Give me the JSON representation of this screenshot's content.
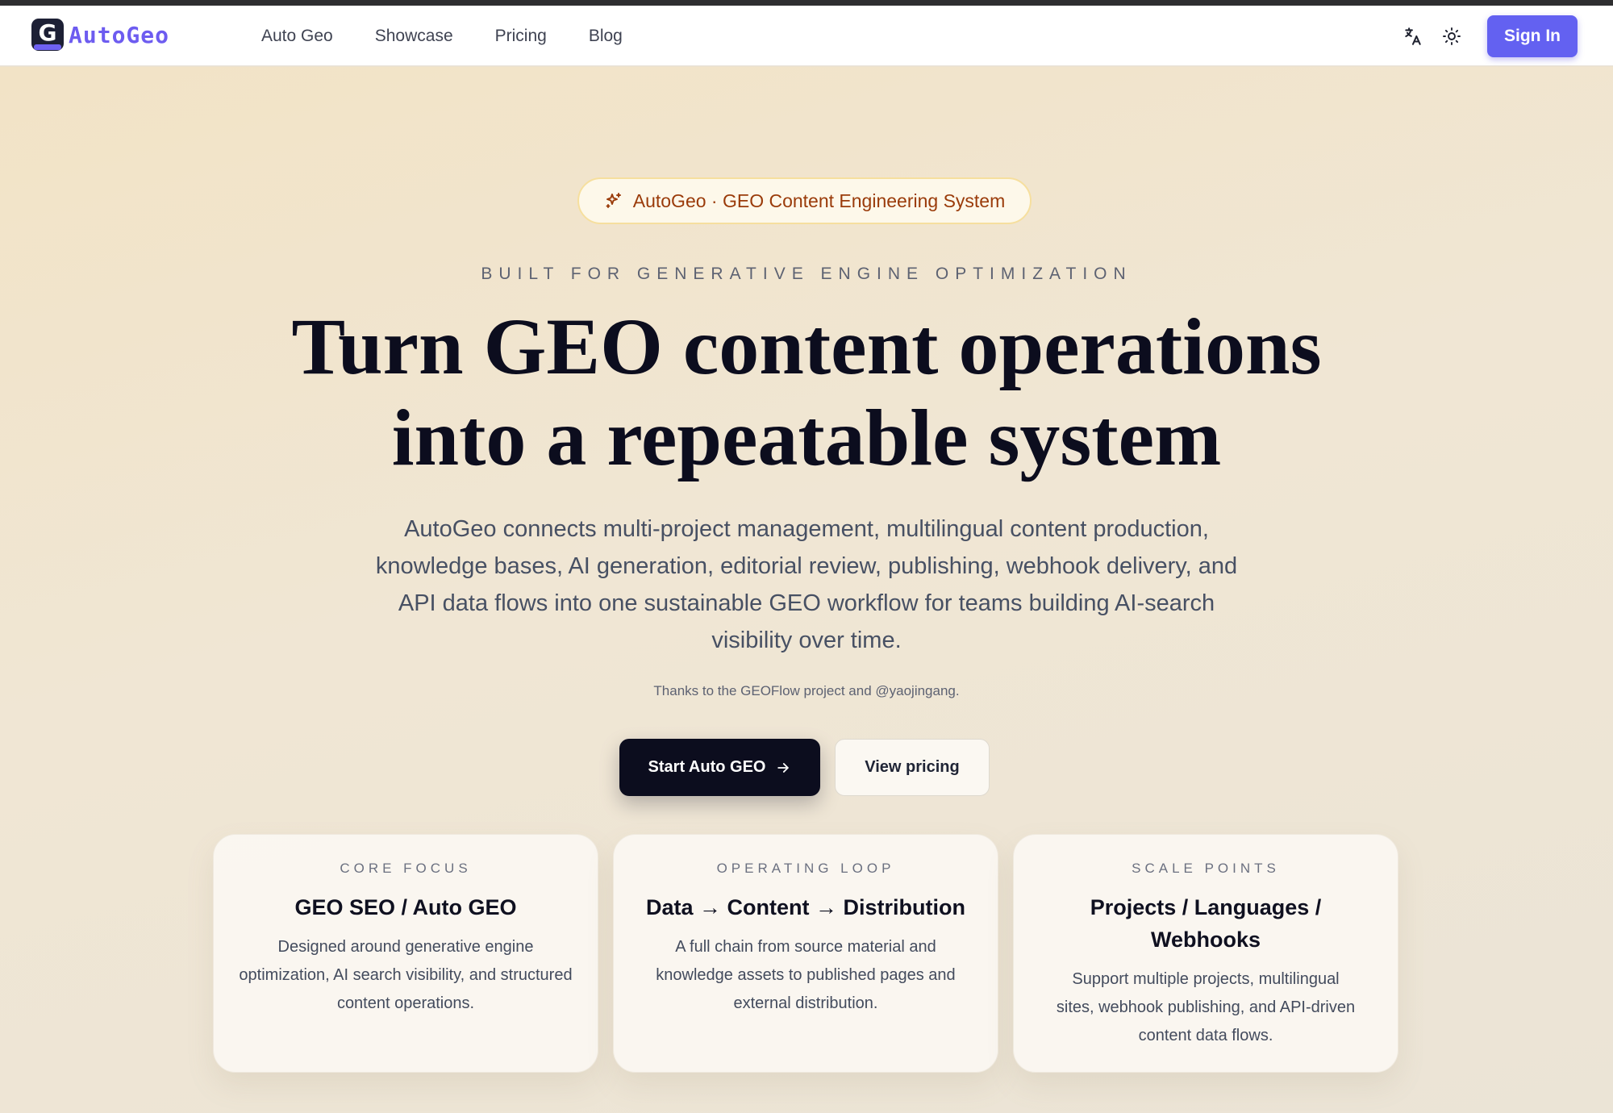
{
  "brand": {
    "logo_letter": "G",
    "name": "AutoGeo"
  },
  "nav": {
    "links": [
      "Auto Geo",
      "Showcase",
      "Pricing",
      "Blog"
    ],
    "sign_in": "Sign In"
  },
  "hero": {
    "badge": "AutoGeo · GEO Content Engineering System",
    "eyebrow": "BUILT FOR GENERATIVE ENGINE OPTIMIZATION",
    "headline_line1": "Turn GEO content operations",
    "headline_line2": "into a repeatable system",
    "lead": "AutoGeo connects multi-project management, multilingual content production, knowledge bases, AI generation, editorial review, publishing, webhook delivery, and API data flows into one sustainable GEO workflow for teams building AI-search visibility over time.",
    "thanks": "Thanks to the GEOFlow project and @yaojingang.",
    "cta_primary": "Start Auto GEO",
    "cta_secondary": "View pricing"
  },
  "cards": [
    {
      "kicker": "CORE FOCUS",
      "title": "GEO SEO / Auto GEO",
      "body": "Designed around generative engine optimization, AI search visibility, and structured content operations."
    },
    {
      "kicker": "OPERATING LOOP",
      "title": "Data → Content → Distribution",
      "body": "A full chain from source material and knowledge assets to published pages and external distribution."
    },
    {
      "kicker": "SCALE POINTS",
      "title": "Projects / Languages / Webhooks",
      "body": "Support multiple projects, multilingual sites, webhook publishing, and API-driven content data flows."
    }
  ],
  "icons": {
    "translate": "translate-icon",
    "theme": "sun-icon",
    "badge": "sparkles-icon",
    "cta": "arrow-right-icon"
  },
  "colors": {
    "accent": "#6361f1",
    "badge_text": "#9a3b0a",
    "dark": "#0c0d1e"
  }
}
